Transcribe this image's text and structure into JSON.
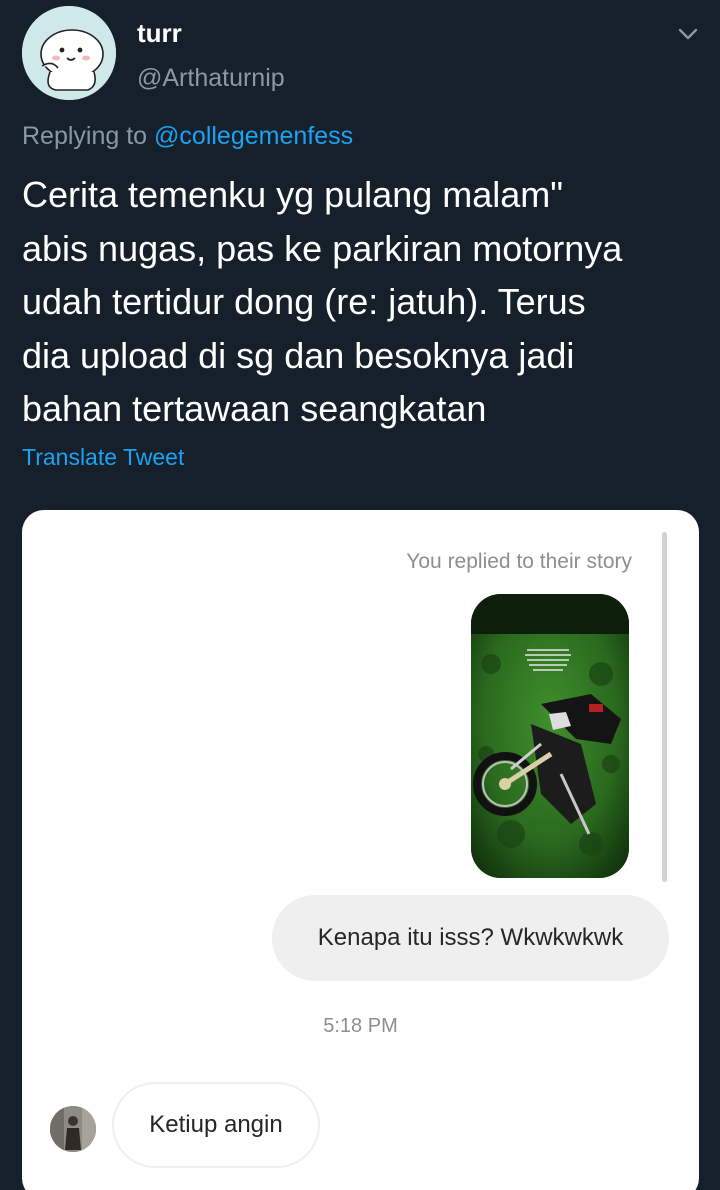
{
  "tweet": {
    "display_name": "turr",
    "handle": "@Arthaturnip",
    "replying_prefix": "Replying to ",
    "replying_mention": "@collegemenfess",
    "text": "Cerita temenku yg pulang malam\"\nabis nugas, pas ke parkiran motornya\nudah tertidur dong (re: jatuh). Terus\ndia upload di sg dan besoknya jadi\nbahan tertawaan seangkatan",
    "translate_label": "Translate Tweet",
    "menu_icon": "chevron-down-icon"
  },
  "dm": {
    "replied_label": "You replied to their story",
    "outgoing_message": "Kenapa itu isss? Wkwkwkwk",
    "timestamp": "5:18 PM",
    "incoming_message": "Ketiup angin"
  },
  "colors": {
    "background": "#15202b",
    "secondary_text": "#8899a6",
    "link": "#1da1f2",
    "card": "#ffffff",
    "bubble_out": "#efefef"
  }
}
